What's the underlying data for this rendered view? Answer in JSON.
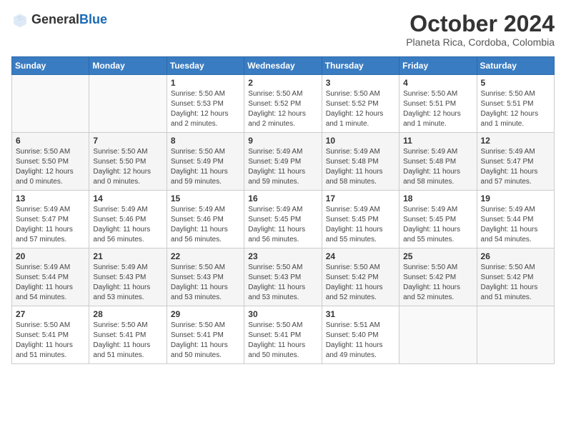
{
  "logo": {
    "general": "General",
    "blue": "Blue"
  },
  "title": "October 2024",
  "subtitle": "Planeta Rica, Cordoba, Colombia",
  "days_of_week": [
    "Sunday",
    "Monday",
    "Tuesday",
    "Wednesday",
    "Thursday",
    "Friday",
    "Saturday"
  ],
  "weeks": [
    [
      {
        "day": "",
        "info": ""
      },
      {
        "day": "",
        "info": ""
      },
      {
        "day": "1",
        "info": "Sunrise: 5:50 AM\nSunset: 5:53 PM\nDaylight: 12 hours\nand 2 minutes."
      },
      {
        "day": "2",
        "info": "Sunrise: 5:50 AM\nSunset: 5:52 PM\nDaylight: 12 hours\nand 2 minutes."
      },
      {
        "day": "3",
        "info": "Sunrise: 5:50 AM\nSunset: 5:52 PM\nDaylight: 12 hours\nand 1 minute."
      },
      {
        "day": "4",
        "info": "Sunrise: 5:50 AM\nSunset: 5:51 PM\nDaylight: 12 hours\nand 1 minute."
      },
      {
        "day": "5",
        "info": "Sunrise: 5:50 AM\nSunset: 5:51 PM\nDaylight: 12 hours\nand 1 minute."
      }
    ],
    [
      {
        "day": "6",
        "info": "Sunrise: 5:50 AM\nSunset: 5:50 PM\nDaylight: 12 hours\nand 0 minutes."
      },
      {
        "day": "7",
        "info": "Sunrise: 5:50 AM\nSunset: 5:50 PM\nDaylight: 12 hours\nand 0 minutes."
      },
      {
        "day": "8",
        "info": "Sunrise: 5:50 AM\nSunset: 5:49 PM\nDaylight: 11 hours\nand 59 minutes."
      },
      {
        "day": "9",
        "info": "Sunrise: 5:49 AM\nSunset: 5:49 PM\nDaylight: 11 hours\nand 59 minutes."
      },
      {
        "day": "10",
        "info": "Sunrise: 5:49 AM\nSunset: 5:48 PM\nDaylight: 11 hours\nand 58 minutes."
      },
      {
        "day": "11",
        "info": "Sunrise: 5:49 AM\nSunset: 5:48 PM\nDaylight: 11 hours\nand 58 minutes."
      },
      {
        "day": "12",
        "info": "Sunrise: 5:49 AM\nSunset: 5:47 PM\nDaylight: 11 hours\nand 57 minutes."
      }
    ],
    [
      {
        "day": "13",
        "info": "Sunrise: 5:49 AM\nSunset: 5:47 PM\nDaylight: 11 hours\nand 57 minutes."
      },
      {
        "day": "14",
        "info": "Sunrise: 5:49 AM\nSunset: 5:46 PM\nDaylight: 11 hours\nand 56 minutes."
      },
      {
        "day": "15",
        "info": "Sunrise: 5:49 AM\nSunset: 5:46 PM\nDaylight: 11 hours\nand 56 minutes."
      },
      {
        "day": "16",
        "info": "Sunrise: 5:49 AM\nSunset: 5:45 PM\nDaylight: 11 hours\nand 56 minutes."
      },
      {
        "day": "17",
        "info": "Sunrise: 5:49 AM\nSunset: 5:45 PM\nDaylight: 11 hours\nand 55 minutes."
      },
      {
        "day": "18",
        "info": "Sunrise: 5:49 AM\nSunset: 5:45 PM\nDaylight: 11 hours\nand 55 minutes."
      },
      {
        "day": "19",
        "info": "Sunrise: 5:49 AM\nSunset: 5:44 PM\nDaylight: 11 hours\nand 54 minutes."
      }
    ],
    [
      {
        "day": "20",
        "info": "Sunrise: 5:49 AM\nSunset: 5:44 PM\nDaylight: 11 hours\nand 54 minutes."
      },
      {
        "day": "21",
        "info": "Sunrise: 5:49 AM\nSunset: 5:43 PM\nDaylight: 11 hours\nand 53 minutes."
      },
      {
        "day": "22",
        "info": "Sunrise: 5:50 AM\nSunset: 5:43 PM\nDaylight: 11 hours\nand 53 minutes."
      },
      {
        "day": "23",
        "info": "Sunrise: 5:50 AM\nSunset: 5:43 PM\nDaylight: 11 hours\nand 53 minutes."
      },
      {
        "day": "24",
        "info": "Sunrise: 5:50 AM\nSunset: 5:42 PM\nDaylight: 11 hours\nand 52 minutes."
      },
      {
        "day": "25",
        "info": "Sunrise: 5:50 AM\nSunset: 5:42 PM\nDaylight: 11 hours\nand 52 minutes."
      },
      {
        "day": "26",
        "info": "Sunrise: 5:50 AM\nSunset: 5:42 PM\nDaylight: 11 hours\nand 51 minutes."
      }
    ],
    [
      {
        "day": "27",
        "info": "Sunrise: 5:50 AM\nSunset: 5:41 PM\nDaylight: 11 hours\nand 51 minutes."
      },
      {
        "day": "28",
        "info": "Sunrise: 5:50 AM\nSunset: 5:41 PM\nDaylight: 11 hours\nand 51 minutes."
      },
      {
        "day": "29",
        "info": "Sunrise: 5:50 AM\nSunset: 5:41 PM\nDaylight: 11 hours\nand 50 minutes."
      },
      {
        "day": "30",
        "info": "Sunrise: 5:50 AM\nSunset: 5:41 PM\nDaylight: 11 hours\nand 50 minutes."
      },
      {
        "day": "31",
        "info": "Sunrise: 5:51 AM\nSunset: 5:40 PM\nDaylight: 11 hours\nand 49 minutes."
      },
      {
        "day": "",
        "info": ""
      },
      {
        "day": "",
        "info": ""
      }
    ]
  ]
}
